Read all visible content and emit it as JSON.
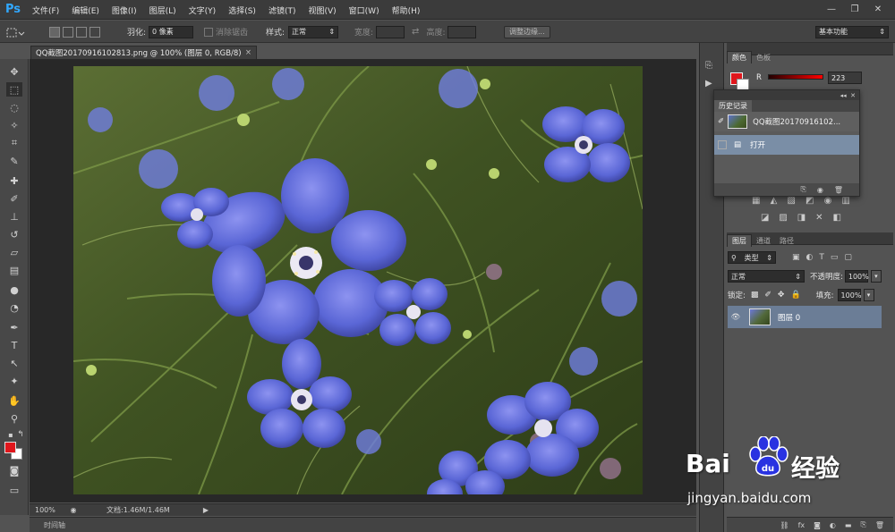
{
  "app": {
    "logo": "Ps"
  },
  "menu": [
    "文件(F)",
    "编辑(E)",
    "图像(I)",
    "图层(L)",
    "文字(Y)",
    "选择(S)",
    "滤镜(T)",
    "视图(V)",
    "窗口(W)",
    "帮助(H)"
  ],
  "window_controls": {
    "minimize": "—",
    "restore": "❐",
    "close": "✕"
  },
  "options": {
    "feather_label": "羽化:",
    "feather_value": "0 像素",
    "antialias_label": "消除锯齿",
    "style_label": "样式:",
    "style_value": "正常",
    "width_label": "宽度:",
    "height_label": "高度:",
    "refine_button": "调整边缘...",
    "workspace": "基本功能"
  },
  "document": {
    "tab_title": "QQ截图20170916102813.png @ 100% (图层 0, RGB/8)",
    "tab_close": "×"
  },
  "status": {
    "zoom": "100%",
    "doc_info": "文档:1.46M/1.46M",
    "timeline": "时间轴"
  },
  "color_panel": {
    "tabs": [
      "颜色",
      "色板"
    ],
    "channel": "R",
    "value": "223"
  },
  "history": {
    "tab": "历史记录",
    "snapshot_name": "QQ截图20170916102...",
    "steps": [
      "打开"
    ]
  },
  "layers": {
    "tabs": [
      "图层",
      "通道",
      "路径"
    ],
    "filter_kind": "类型",
    "blend_mode": "正常",
    "opacity_label": "不透明度:",
    "opacity_value": "100%",
    "lock_label": "锁定:",
    "fill_label": "填充:",
    "fill_value": "100%",
    "items": [
      {
        "name": "图层 0"
      }
    ]
  },
  "watermark": {
    "brand_left": "Bai",
    "brand_right": "经验",
    "url": "jingyan.baidu.com"
  },
  "colors": {
    "foreground": "#e0161c",
    "background": "#ffffff",
    "selected_layer": "#6b7d96",
    "selected_history": "#7a8ea6",
    "baidu_blue": "#2932e1"
  }
}
